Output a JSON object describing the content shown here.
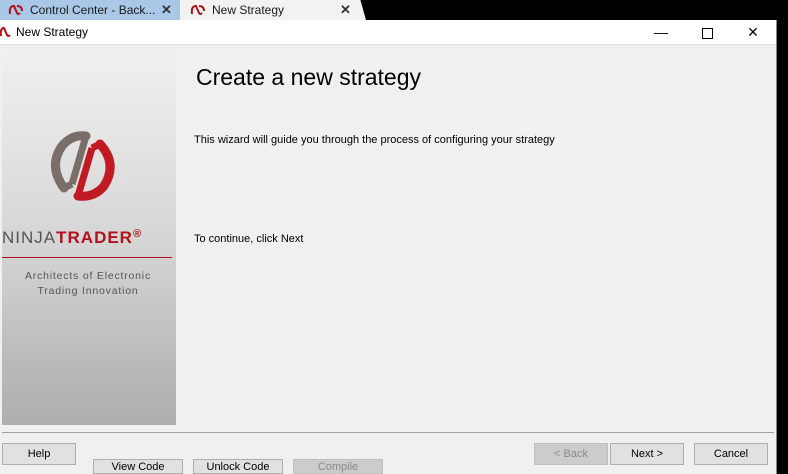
{
  "tabs": [
    {
      "label": "Control Center - Back...",
      "close": "✕"
    },
    {
      "label": "New Strategy",
      "close": "✕"
    }
  ],
  "window": {
    "title": "New Strategy",
    "controls": {
      "minimize": "—",
      "close": "✕"
    }
  },
  "banner": {
    "brand_part1": "NINJA",
    "brand_part2": "TRADER",
    "brand_mark": "®",
    "tagline_line1": "Architects of Electronic",
    "tagline_line2": "Trading Innovation",
    "colors": {
      "accent": "#b1121b",
      "grey": "#555555"
    }
  },
  "wizard": {
    "heading": "Create a new strategy",
    "intro": "This wizard will guide you through the process of configuring your strategy",
    "continue_text": "To continue, click Next"
  },
  "buttons": {
    "help": "Help",
    "back": "< Back",
    "next": "Next >",
    "cancel": "Cancel",
    "view_code": "View Code",
    "unlock_code": "Unlock Code",
    "compile": "Compile"
  }
}
